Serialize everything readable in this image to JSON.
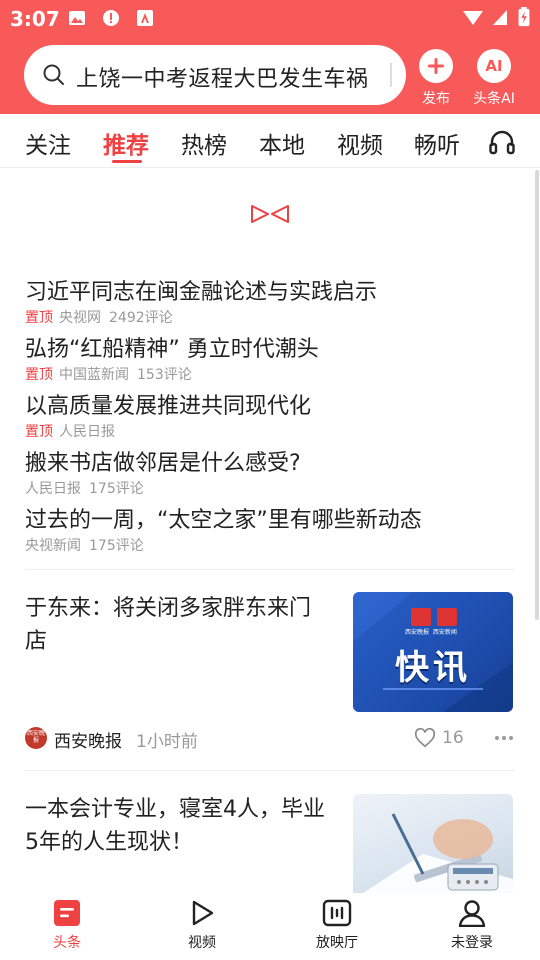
{
  "status_bar": {
    "time": "3:07"
  },
  "search": {
    "query": "上饶一中考返程大巴发生车祸"
  },
  "header_actions": [
    {
      "label": "发布",
      "icon": "plus-icon"
    },
    {
      "label": "头条AI",
      "icon": "ai-icon",
      "badge": "AI"
    }
  ],
  "tabs": [
    {
      "label": "关注"
    },
    {
      "label": "推荐",
      "active": true
    },
    {
      "label": "热榜"
    },
    {
      "label": "本地"
    },
    {
      "label": "视频"
    },
    {
      "label": "畅听"
    }
  ],
  "pinned_news": [
    {
      "title": "习近平同志在闽金融论述与实践启示",
      "tag": "置顶",
      "source": "央视网",
      "comments": "2492评论"
    },
    {
      "title": "弘扬“红船精神” 勇立时代潮头",
      "tag": "置顶",
      "source": "中国蓝新闻",
      "comments": "153评论"
    },
    {
      "title": "以高质量发展推进共同现代化",
      "tag": "置顶",
      "source": "人民日报",
      "comments": ""
    },
    {
      "title": "搬来书店做邻居是什么感受?",
      "tag": "",
      "source": "人民日报",
      "comments": "175评论"
    },
    {
      "title": "过去的一周，“太空之家”里有哪些新动态",
      "tag": "",
      "source": "央视新闻",
      "comments": "175评论"
    }
  ],
  "feed": [
    {
      "title": "于东来：将关闭多家胖东来门店",
      "thumb_text": "快讯",
      "thumb_logos": [
        "西安晚报",
        "西安新闻"
      ],
      "source": "西安晚报",
      "source_logo_text": "西安晚报",
      "time": "1小时前",
      "likes": "16"
    },
    {
      "title": "一本会计专业，寝室4人，毕业5年的人生现状！"
    }
  ],
  "bottom_nav": [
    {
      "label": "头条",
      "icon": "headline-icon",
      "active": true
    },
    {
      "label": "视频",
      "icon": "play-icon"
    },
    {
      "label": "放映厅",
      "icon": "theater-icon"
    },
    {
      "label": "未登录",
      "icon": "user-icon"
    }
  ],
  "colors": {
    "brand_red": "#f85959",
    "accent_red": "#f04142",
    "thumb_blue": "#1e4fb0"
  }
}
